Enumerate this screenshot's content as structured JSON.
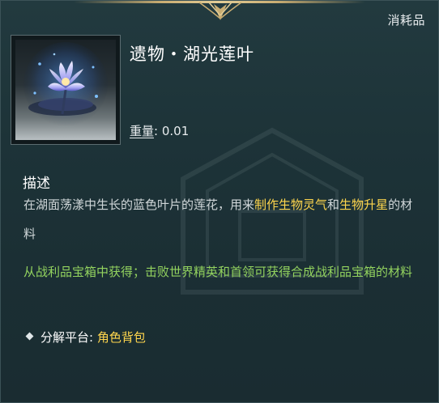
{
  "tooltip": {
    "category": "消耗品",
    "item_name": "遗物・湖光莲叶",
    "weight_label": "重量",
    "weight_sep": ":",
    "weight_value": "0.01",
    "section_title": "描述",
    "description": {
      "part1": "在湖面荡漾中生长的蓝色叶片的莲花，用来",
      "hl1": "制作生物灵气",
      "part2": "和",
      "hl2": "生物升星",
      "part3": "的材料"
    },
    "source_text": "从战利品宝箱中获得；击败世界精英和首领可获得合成战利品宝箱的材料",
    "platform": {
      "label": "分解平台:",
      "value": "角色背包"
    },
    "icon_name": "blue-lotus-icon",
    "colors": {
      "background": "#1d3338",
      "highlight": "#ffd64d",
      "source_green": "#93d35f",
      "ornament_gold": "#c9ad72"
    }
  }
}
